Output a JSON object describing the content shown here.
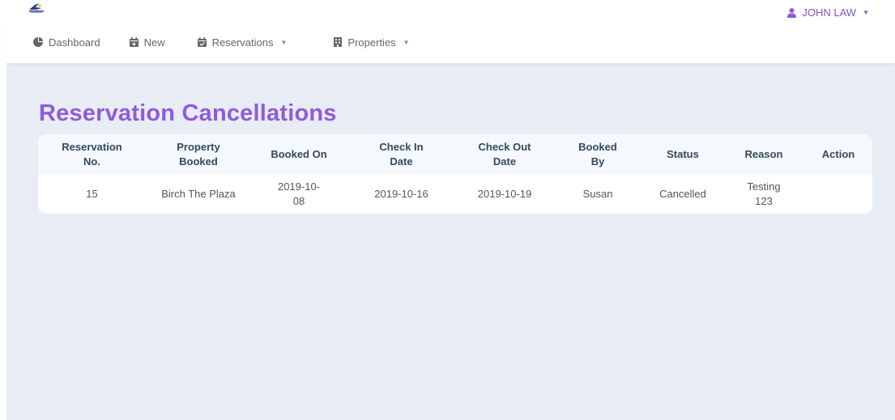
{
  "user": {
    "name": "JOHN LAW"
  },
  "nav": {
    "items": [
      {
        "label": "Dashboard",
        "icon": "pie-chart-icon",
        "dropdown": false
      },
      {
        "label": "New",
        "icon": "calendar-plus-icon",
        "dropdown": false
      },
      {
        "label": "Reservations",
        "icon": "calendar-check-icon",
        "dropdown": true
      },
      {
        "label": "Properties",
        "icon": "building-icon",
        "dropdown": true
      }
    ]
  },
  "page": {
    "title": "Reservation Cancellations"
  },
  "table": {
    "headers": [
      {
        "line1": "Reservation",
        "line2": "No."
      },
      {
        "line1": "Property",
        "line2": "Booked"
      },
      {
        "line1": "Booked On",
        "line2": ""
      },
      {
        "line1": "Check In",
        "line2": "Date"
      },
      {
        "line1": "Check Out",
        "line2": "Date"
      },
      {
        "line1": "Booked",
        "line2": "By"
      },
      {
        "line1": "Status",
        "line2": ""
      },
      {
        "line1": "Reason",
        "line2": ""
      },
      {
        "line1": "Action",
        "line2": ""
      }
    ],
    "rows": [
      {
        "reservation_no": "15",
        "property": "Birch The Plaza",
        "booked_on_1": "2019-10-",
        "booked_on_2": "08",
        "check_in": "2019-10-16",
        "check_out": "2019-10-19",
        "booked_by": "Susan",
        "status": "Cancelled",
        "reason_1": "Testing",
        "reason_2": "123",
        "action": ""
      }
    ]
  },
  "colors": {
    "accent": "#8e5cd8",
    "user": "#7e57c2",
    "background": "#e8ecf4"
  }
}
